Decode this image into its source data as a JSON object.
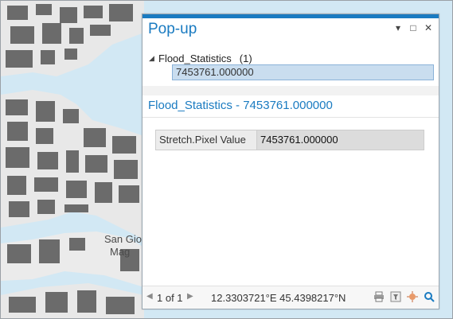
{
  "map": {
    "labels": [
      "San Gio",
      "Mag"
    ]
  },
  "popup": {
    "title": "Pop-up",
    "controls": {
      "dropdown": "▾",
      "maximize": "□",
      "close": "✕"
    },
    "tree": {
      "layer_name": "Flood_Statistics",
      "layer_count": "(1)",
      "item": "7453761.000000"
    },
    "feature_title": "Flood_Statistics - 7453761.000000",
    "attributes": [
      {
        "field": "Stretch.Pixel Value",
        "value": "7453761.000000"
      }
    ],
    "footer": {
      "paging": "1 of 1",
      "coordinates": "12.3303721°E 45.4398217°N"
    },
    "icons": [
      "print-icon",
      "filter-icon",
      "flash-icon",
      "zoom-to-icon"
    ]
  }
}
